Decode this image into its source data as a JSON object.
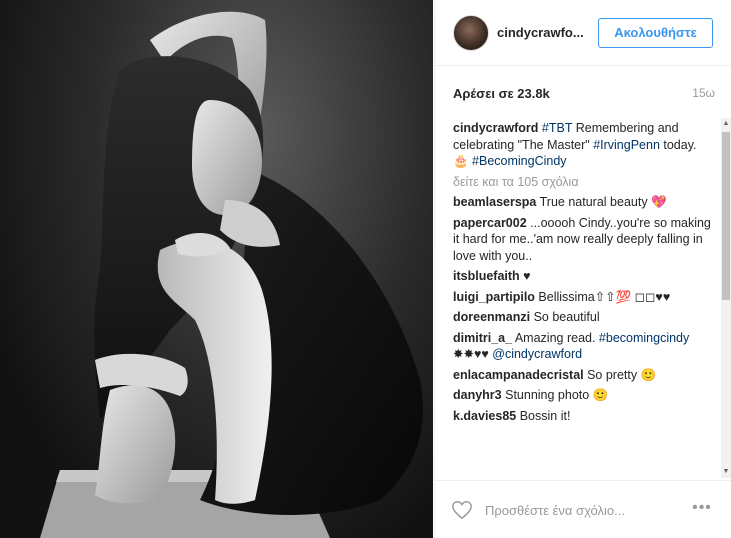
{
  "post": {
    "username": "cindycrawfo...",
    "follow_label": "Ακολουθήστε",
    "likes": "Αρέσει σε 23.8k",
    "time": "15ω"
  },
  "caption": {
    "user": "cindycrawford",
    "tag1": "#TBT",
    "text1": " Remembering and celebrating \"The Master\" ",
    "tag2": "#IrvingPenn",
    "text2": " today. 🎂 ",
    "tag3": "#BecomingCindy"
  },
  "load_more": "δείτε και τα 105 σχόλια",
  "comments": [
    {
      "user": "beamlaserspa",
      "text": " True natural beauty 💖"
    },
    {
      "user": "papercar002",
      "text": " ...ooooh Cindy..you're so making it hard for me..'am now really deeply falling in love with you.."
    },
    {
      "user": "itsbluefaith",
      "text": " ♥"
    },
    {
      "user": "luigi_partipilo",
      "text": " Bellissima⇧⇧💯 ◻◻♥♥"
    },
    {
      "user": "doreenmanzi",
      "text": " So beautiful"
    },
    {
      "user": "dimitri_a_",
      "text": " Amazing read. ",
      "tag": "#becomingcindy",
      "text_after": " ✸✸♥♥ ",
      "mention": "@cindycrawford"
    },
    {
      "user": "enlacampanadecristal",
      "text": " So pretty 🙂"
    },
    {
      "user": "danyhr3",
      "text": " Stunning photo 🙂"
    },
    {
      "user": "k.davies85",
      "text": " Bossin it!"
    }
  ],
  "footer": {
    "comment_placeholder": "Προσθέστε ένα σχόλιο...",
    "more_label": "•••"
  },
  "icons": {
    "heart": "heart-icon",
    "more": "more-options-icon",
    "avatar": "avatar"
  },
  "colors": {
    "accent": "#3897f0",
    "tag": "#003569",
    "muted": "#999999"
  }
}
